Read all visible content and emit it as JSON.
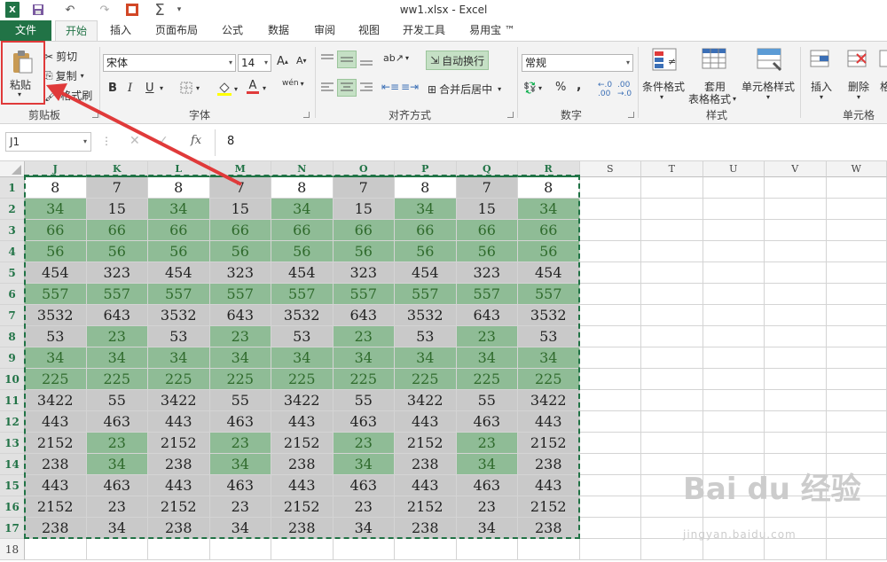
{
  "window": {
    "title": "ww1.xlsx - Excel"
  },
  "quick_access": {
    "undo": "↶",
    "redo": "↷",
    "sigma": "Σ"
  },
  "tabs": [
    {
      "label": "文件"
    },
    {
      "label": "开始"
    },
    {
      "label": "插入"
    },
    {
      "label": "页面布局"
    },
    {
      "label": "公式"
    },
    {
      "label": "数据"
    },
    {
      "label": "审阅"
    },
    {
      "label": "视图"
    },
    {
      "label": "开发工具"
    },
    {
      "label": "易用宝 ™"
    }
  ],
  "clipboard": {
    "paste": "粘贴",
    "cut": "剪切",
    "copy": "复制",
    "format_painter": "格式刷",
    "group": "剪贴板"
  },
  "font": {
    "name": "宋体",
    "size": "14",
    "bold": "B",
    "italic": "I",
    "underline": "U",
    "grow": "A",
    "shrink": "A",
    "font_color": "A",
    "phonetic": "wén",
    "group": "字体"
  },
  "alignment": {
    "wrap_text": "自动换行",
    "merge_center": "合并后居中",
    "group": "对齐方式"
  },
  "number": {
    "format": "常规",
    "percent": "%",
    "comma": ",",
    "group": "数字"
  },
  "styles": {
    "conditional": "条件格式",
    "table_line1": "套用",
    "table_line2": "表格格式",
    "cell_styles": "单元格样式",
    "group": "样式"
  },
  "cells": {
    "insert": "插入",
    "delete": "删除",
    "format": "格",
    "group": "单元格"
  },
  "formula_bar": {
    "name_box": "J1",
    "fx": "fx",
    "value": "8"
  },
  "columns": [
    "J",
    "K",
    "L",
    "M",
    "N",
    "O",
    "P",
    "Q",
    "R",
    "S",
    "T",
    "U",
    "V",
    "W"
  ],
  "rows": [
    "1",
    "2",
    "3",
    "4",
    "5",
    "6",
    "7",
    "8",
    "9",
    "10",
    "11",
    "12",
    "13",
    "14",
    "15",
    "16",
    "17",
    "18"
  ],
  "cell_values": [
    [
      "8",
      "7",
      "8",
      "7",
      "8",
      "7",
      "8",
      "7",
      "8"
    ],
    [
      "34",
      "15",
      "34",
      "15",
      "34",
      "15",
      "34",
      "15",
      "34"
    ],
    [
      "66",
      "66",
      "66",
      "66",
      "66",
      "66",
      "66",
      "66",
      "66"
    ],
    [
      "56",
      "56",
      "56",
      "56",
      "56",
      "56",
      "56",
      "56",
      "56"
    ],
    [
      "454",
      "323",
      "454",
      "323",
      "454",
      "323",
      "454",
      "323",
      "454"
    ],
    [
      "557",
      "557",
      "557",
      "557",
      "557",
      "557",
      "557",
      "557",
      "557"
    ],
    [
      "3532",
      "643",
      "3532",
      "643",
      "3532",
      "643",
      "3532",
      "643",
      "3532"
    ],
    [
      "53",
      "23",
      "53",
      "23",
      "53",
      "23",
      "53",
      "23",
      "53"
    ],
    [
      "34",
      "34",
      "34",
      "34",
      "34",
      "34",
      "34",
      "34",
      "34"
    ],
    [
      "225",
      "225",
      "225",
      "225",
      "225",
      "225",
      "225",
      "225",
      "225"
    ],
    [
      "3422",
      "55",
      "3422",
      "55",
      "3422",
      "55",
      "3422",
      "55",
      "3422"
    ],
    [
      "443",
      "463",
      "443",
      "463",
      "443",
      "463",
      "443",
      "463",
      "443"
    ],
    [
      "2152",
      "23",
      "2152",
      "23",
      "2152",
      "23",
      "2152",
      "23",
      "2152"
    ],
    [
      "238",
      "34",
      "238",
      "34",
      "238",
      "34",
      "238",
      "34",
      "238"
    ],
    [
      "443",
      "463",
      "443",
      "463",
      "443",
      "463",
      "443",
      "463",
      "443"
    ],
    [
      "2152",
      "23",
      "2152",
      "23",
      "2152",
      "23",
      "2152",
      "23",
      "2152"
    ],
    [
      "238",
      "34",
      "238",
      "34",
      "238",
      "34",
      "238",
      "34",
      "238"
    ]
  ],
  "cell_fills": [
    "wswswswsw",
    "gsgsgsgsg",
    "ggggggggg",
    "ggggggggg",
    "sssssssss",
    "ggggggggg",
    "sssssssss",
    "sgsgsgsgs",
    "ggggggggg",
    "ggggggggg",
    "sssssssss",
    "sssssssss",
    "sgsgsgsgs",
    "sgsgsgsgs",
    "sssssssss",
    "sssssssss",
    "sssssssss"
  ],
  "colors": {
    "excel_green": "#217346",
    "green_fill": "#8fbc96",
    "gray_fill": "#c9c9c9",
    "annotation_red": "#e03a3a"
  },
  "watermark": {
    "logo": "Bai du 经验",
    "url": "jingyan.baidu.com"
  }
}
